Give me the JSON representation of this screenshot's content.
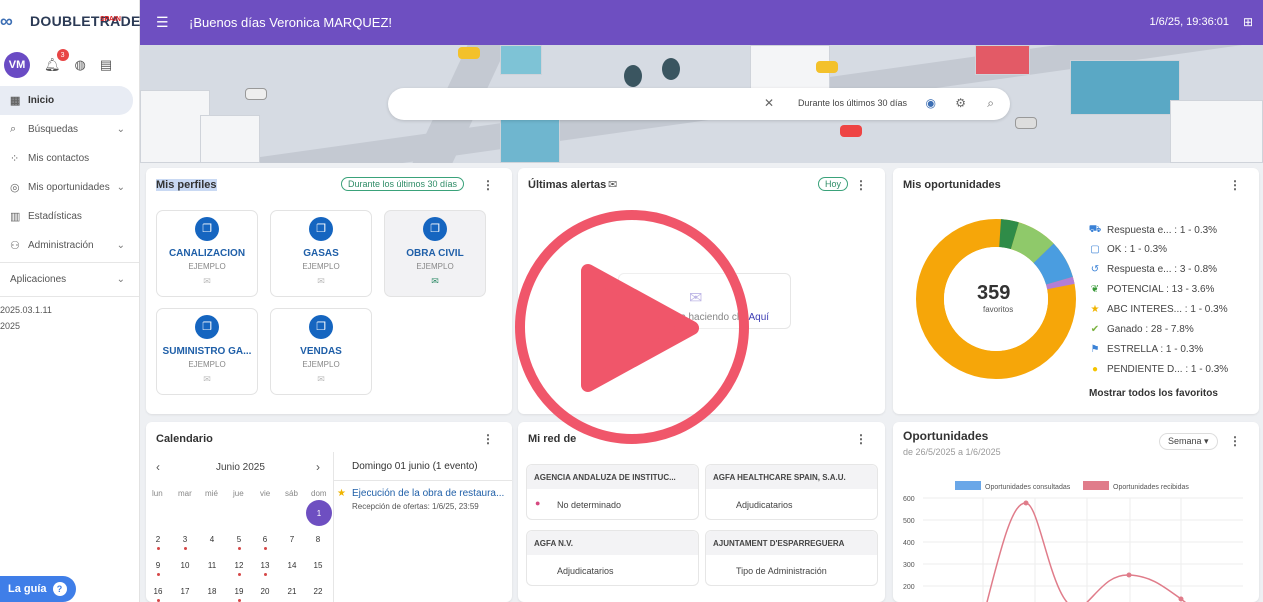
{
  "app": {
    "logo_text": "DOUBLETRADE",
    "logo_sub": "SPAIN"
  },
  "user": {
    "initials": "VM",
    "notifications": "3"
  },
  "nav": [
    {
      "label": "Inicio",
      "icon": "grid-icon",
      "glyph": "▦"
    },
    {
      "label": "Búsquedas",
      "icon": "search-icon",
      "glyph": "⌕"
    },
    {
      "label": "Mis contactos",
      "icon": "contacts-icon",
      "glyph": "⁘"
    },
    {
      "label": "Mis oportunidades",
      "icon": "target-icon",
      "glyph": "◎"
    },
    {
      "label": "Estadísticas",
      "icon": "stats-icon",
      "glyph": "▥"
    },
    {
      "label": "Administración",
      "icon": "admin-icon",
      "glyph": "⚇"
    },
    {
      "label": "Aplicaciones",
      "icon": "apps-icon",
      "glyph": ""
    }
  ],
  "versions": [
    "2025.03.1.11",
    "2025"
  ],
  "guide_label": "La guía",
  "topbar": {
    "greeting": "¡Buenos días Veronica MARQUEZ!",
    "datetime": "1/6/25, 19:36:01"
  },
  "search": {
    "period": "Durante los últimos 30 días"
  },
  "profiles": {
    "title": "Mis perfiles",
    "period": "Durante los últimos 30 días",
    "items": [
      {
        "name": "CANALIZACION",
        "sub": "EJEMPLO"
      },
      {
        "name": "GASAS",
        "sub": "EJEMPLO"
      },
      {
        "name": "OBRA CIVIL",
        "sub": "EJEMPLO"
      },
      {
        "name": "SUMINISTRO GA...",
        "sub": "EJEMPLO"
      },
      {
        "name": "VENDAS",
        "sub": "EJEMPLO"
      }
    ]
  },
  "alerts": {
    "title": "Últimas alertas",
    "pill": "Hoy",
    "empty_text": "rtas haciendo clic",
    "link": "Aquí"
  },
  "opportunities": {
    "title": "Mis oportunidades",
    "total": "359",
    "total_label": "favoritos",
    "show_all": "Mostrar todos los favoritos",
    "legend": [
      {
        "label": "Respuesta e... : 1 - 0.3%",
        "icon": "truck-icon",
        "glyph": "⛟",
        "color": "#3b82d6"
      },
      {
        "label": "OK : 1 - 0.3%",
        "icon": "chat-icon",
        "glyph": "▢",
        "color": "#3b82d6"
      },
      {
        "label": "Respuesta e... : 3 - 0.8%",
        "icon": "history-icon",
        "glyph": "↺",
        "color": "#3b82d6"
      },
      {
        "label": "POTENCIAL : 13 - 3.6%",
        "icon": "leaf-icon",
        "glyph": "❦",
        "color": "#3a9a3a"
      },
      {
        "label": "ABC INTERES... : 1 - 0.3%",
        "icon": "star-icon",
        "glyph": "★",
        "color": "#f0b400"
      },
      {
        "label": "Ganado : 28 - 7.8%",
        "icon": "check-icon",
        "glyph": "✔",
        "color": "#7cb342"
      },
      {
        "label": "ESTRELLA : 1 - 0.3%",
        "icon": "paint-icon",
        "glyph": "⚑",
        "color": "#3b82d6"
      },
      {
        "label": "PENDIENTE D... : 1 - 0.3%",
        "icon": "circle-icon",
        "glyph": "●",
        "color": "#f5c400"
      }
    ]
  },
  "calendar": {
    "title": "Calendario",
    "month": "Junio 2025",
    "weekdays": [
      "lun",
      "mar",
      "mié",
      "jue",
      "vie",
      "sáb",
      "dom"
    ],
    "event_day": "Domingo 01 junio (1 evento)",
    "event_title": "Ejecución de la obra de restaura...",
    "event_sub": "Recepción de ofertas: 1/6/25, 23:59",
    "rows": [
      [
        "1"
      ],
      [
        "2",
        "3",
        "4",
        "5",
        "6",
        "7",
        "8"
      ],
      [
        "9",
        "10",
        "11",
        "12",
        "13",
        "14",
        "15"
      ],
      [
        "16",
        "17",
        "18",
        "19",
        "20",
        "21",
        "22"
      ]
    ]
  },
  "network": {
    "title": "Mi red de",
    "items": [
      {
        "name": "AGENCIA ANDALUZA DE INSTITUC...",
        "value": "No determinado"
      },
      {
        "name": "AGFA HEALTHCARE SPAIN, S.A.U.",
        "value": "Adjudicatarios"
      },
      {
        "name": "AGFA N.V.",
        "value": "Adjudicatarios"
      },
      {
        "name": "AJUNTAMENT D'ESPARREGUERA",
        "value": "Tipo de Administración"
      }
    ]
  },
  "opp_chart": {
    "title": "Oportunidades",
    "range": "de 26/5/2025 a 1/6/2025",
    "selector": "Semana"
  },
  "chart_data": {
    "type": "line",
    "series": [
      {
        "name": "Oportunidades consultadas",
        "color": "#6aa7e8"
      },
      {
        "name": "Oportunidades recibidas",
        "color": "#e07c8a"
      }
    ],
    "y_ticks": [
      "600",
      "500",
      "400",
      "300",
      "200"
    ],
    "ylim": [
      200,
      600
    ]
  },
  "colors": {
    "topbar": "#6e4fc1",
    "accent": "#1565c0",
    "play": "#f0566a"
  }
}
